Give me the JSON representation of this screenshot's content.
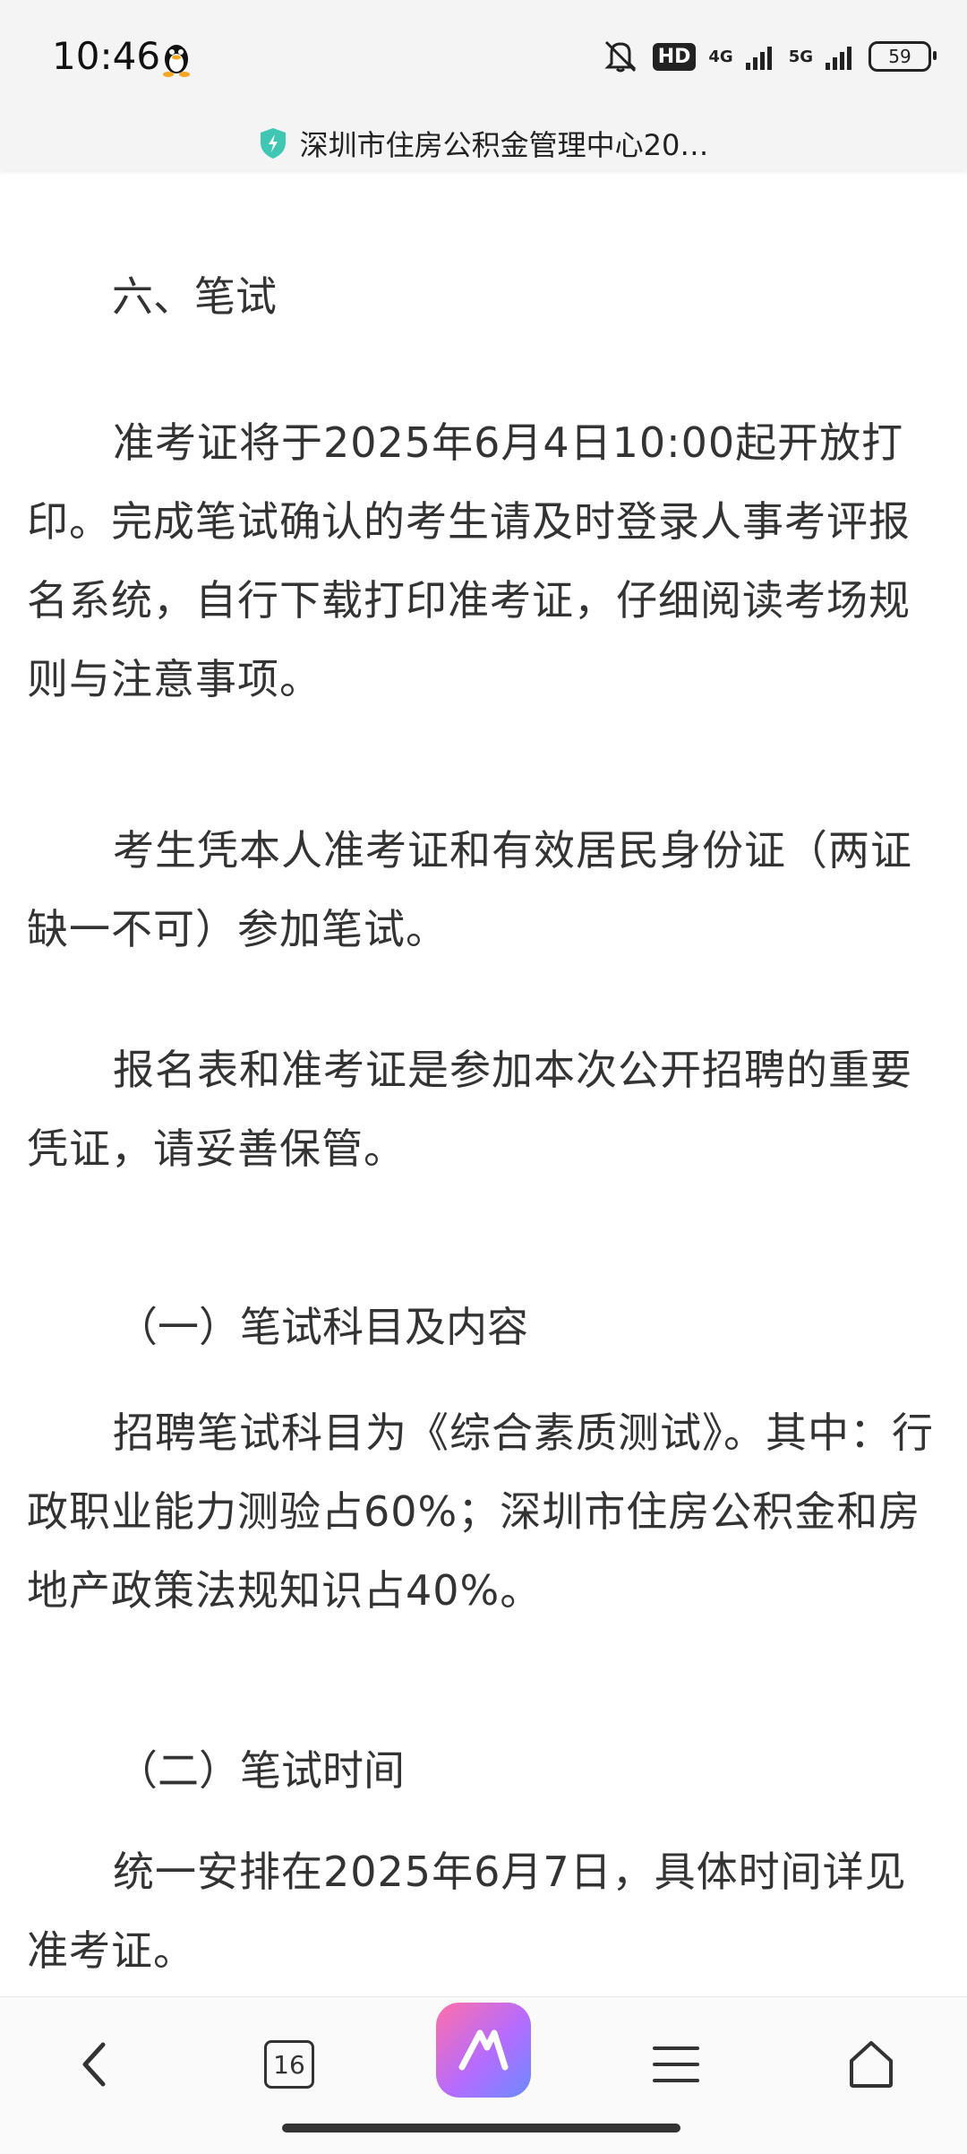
{
  "status_bar": {
    "time": "10:46",
    "hd_label": "HD",
    "net1": "4G",
    "net2": "5G",
    "battery": "59"
  },
  "site": {
    "title": "深圳市住房公积金管理中心20…"
  },
  "article": {
    "section_title": "六、笔试",
    "p1": "准考证将于2025年6月4日10:00起开放打印。完成笔试确认的考生请及时登录人事考评报名系统，自行下载打印准考证，仔细阅读考场规则与注意事项。",
    "p2": "考生凭本人准考证和有效居民身份证（两证缺一不可）参加笔试。",
    "p3": "报名表和准考证是参加本次公开招聘的重要凭证，请妥善保管。",
    "sub1": "（一）笔试科目及内容",
    "p4": "招聘笔试科目为《综合素质测试》。其中：行政职业能力测验占60%；深圳市住房公积金和房地产政策法规知识占40%。",
    "sub2": "（二）笔试时间",
    "p5": "统一安排在2025年6月7日，具体时间详见准考证。"
  },
  "bottom_nav": {
    "tab_count": "16"
  }
}
